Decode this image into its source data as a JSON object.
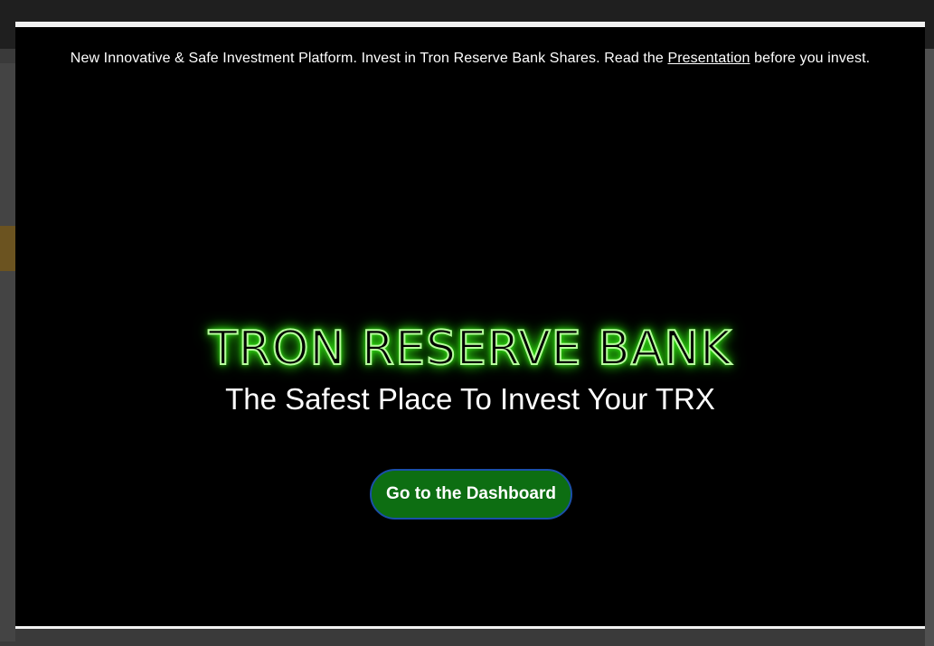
{
  "notice": {
    "text_before": "New Innovative & Safe Investment Platform. Invest in Tron Reserve Bank Shares. Read the ",
    "link_label": "Presentation",
    "text_after": " before you invest."
  },
  "hero": {
    "title": "TRON RESERVE BANK",
    "tagline": "The Safest Place To Invest Your TRX"
  },
  "cta": {
    "label": "Go to the Dashboard"
  },
  "colors": {
    "modal_background": "#000000",
    "title_glow": "#39ff14",
    "button_background": "#0d6e12",
    "button_border": "#1a4fa8",
    "text": "#ffffff"
  }
}
